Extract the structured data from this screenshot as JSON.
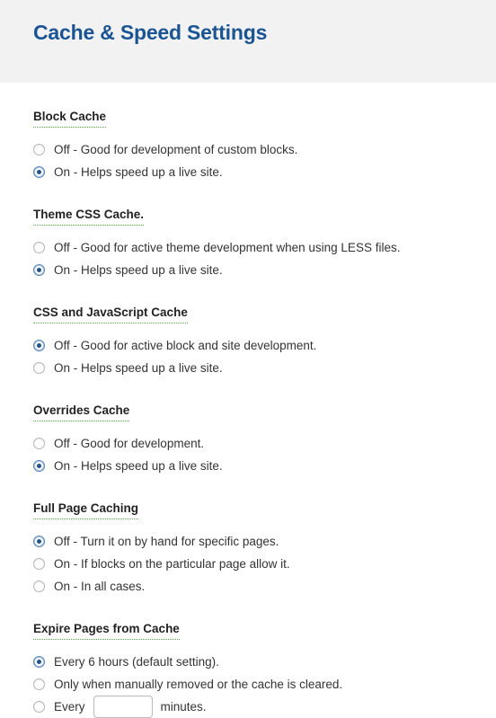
{
  "header": {
    "title": "Cache & Speed Settings",
    "title_color": "#1a5494",
    "background_color": "#f2f2f2"
  },
  "theme": {
    "heading_underline_color": "#5aa84c",
    "radio_selected_color": "#21538c",
    "text_color": "#333333"
  },
  "sections": [
    {
      "heading": "Block Cache",
      "options": [
        {
          "label": "Off - Good for development of custom blocks.",
          "selected": false
        },
        {
          "label": "On - Helps speed up a live site.",
          "selected": true
        }
      ]
    },
    {
      "heading": "Theme CSS Cache.",
      "options": [
        {
          "label": "Off - Good for active theme development when using LESS files.",
          "selected": false
        },
        {
          "label": "On - Helps speed up a live site.",
          "selected": true
        }
      ]
    },
    {
      "heading": "CSS and JavaScript Cache",
      "options": [
        {
          "label": "Off - Good for active block and site development.",
          "selected": true
        },
        {
          "label": "On - Helps speed up a live site.",
          "selected": false
        }
      ]
    },
    {
      "heading": "Overrides Cache",
      "options": [
        {
          "label": "Off - Good for development.",
          "selected": false
        },
        {
          "label": "On - Helps speed up a live site.",
          "selected": true
        }
      ]
    },
    {
      "heading": "Full Page Caching",
      "options": [
        {
          "label": "Off - Turn it on by hand for specific pages.",
          "selected": true
        },
        {
          "label": "On - If blocks on the particular page allow it.",
          "selected": false
        },
        {
          "label": "On - In all cases.",
          "selected": false
        }
      ]
    },
    {
      "heading": "Expire Pages from Cache",
      "options": [
        {
          "label": "Every 6 hours (default setting).",
          "selected": false,
          "is_default_checked": true
        },
        {
          "label": "Only when manually removed or the cache is cleared.",
          "selected": false
        },
        {
          "label": "Every",
          "selected": false,
          "input": {
            "value": "",
            "placeholder": ""
          },
          "label_after": "minutes."
        }
      ]
    }
  ]
}
